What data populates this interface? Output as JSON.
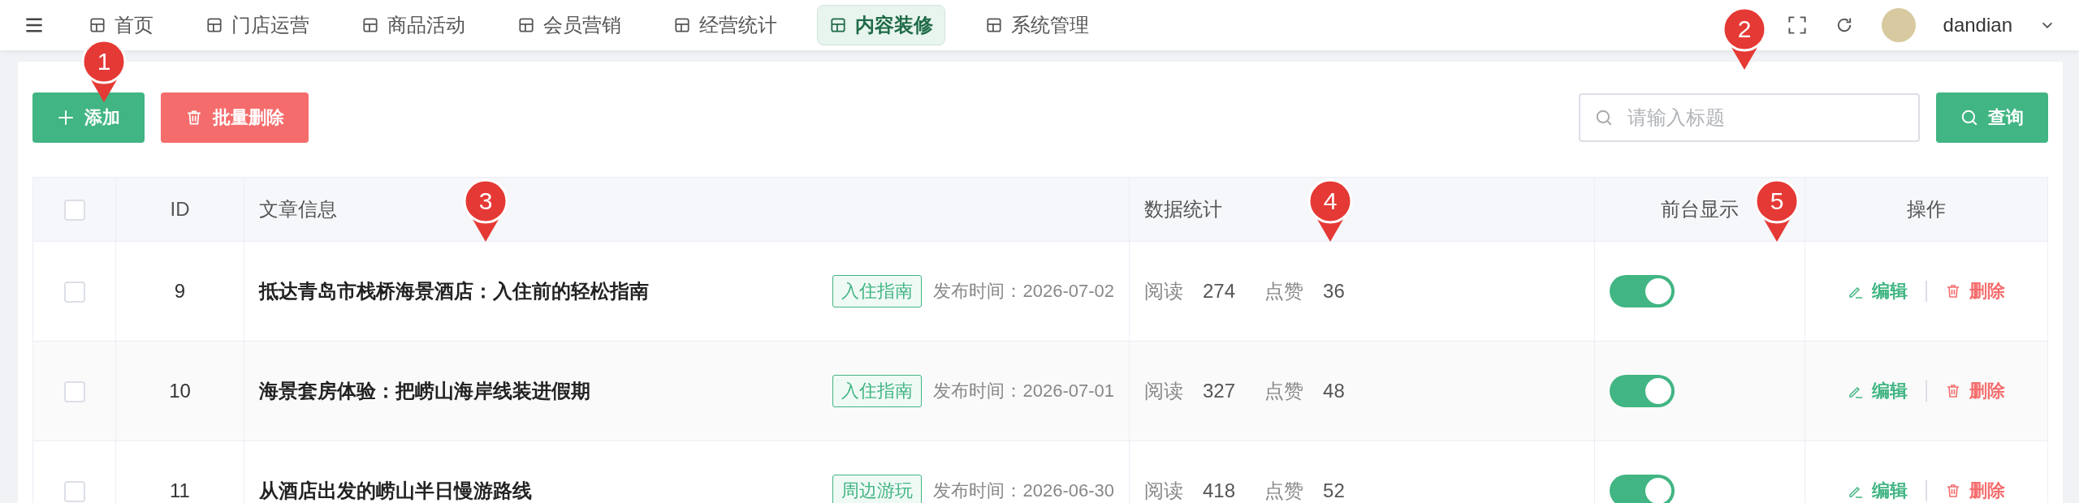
{
  "nav": {
    "items": [
      {
        "label": "首页",
        "selected": false
      },
      {
        "label": "门店运营",
        "selected": false
      },
      {
        "label": "商品活动",
        "selected": false
      },
      {
        "label": "会员营销",
        "selected": false
      },
      {
        "label": "经营统计",
        "selected": false
      },
      {
        "label": "内容装修",
        "selected": true
      },
      {
        "label": "系统管理",
        "selected": false
      }
    ],
    "user": "dandian"
  },
  "toolbar": {
    "add": "添加",
    "batch_delete": "批量删除",
    "search": {
      "placeholder": "请输入标题"
    },
    "query": "查询"
  },
  "table": {
    "select_all_checked": false,
    "columns": [
      "ID",
      "文章信息",
      "数据统计",
      "前台显示",
      "操作"
    ],
    "rows": [
      {
        "checked": false,
        "id": "9",
        "title": "抵达青岛市栈桥海景酒店：入住前的轻松指南",
        "tag": "入住指南",
        "published": "发布时间：2026-07-02",
        "read_label": "阅读",
        "reads": "274",
        "like_label": "点赞",
        "likes": "36",
        "on": true,
        "edit": "编辑",
        "delete": "删除"
      },
      {
        "checked": false,
        "id": "10",
        "title": "海景套房体验：把崂山海岸线装进假期",
        "tag": "入住指南",
        "published": "发布时间：2026-07-01",
        "read_label": "阅读",
        "reads": "327",
        "like_label": "点赞",
        "likes": "48",
        "on": true,
        "edit": "编辑",
        "delete": "删除"
      },
      {
        "checked": false,
        "id": "11",
        "title": "从酒店出发的崂山半日慢游路线",
        "tag": "周边游玩",
        "published": "发布时间：2026-06-30",
        "read_label": "阅读",
        "reads": "418",
        "like_label": "点赞",
        "likes": "52",
        "on": true,
        "edit": "编辑",
        "delete": "删除"
      }
    ]
  },
  "markers": [
    "1",
    "2",
    "3",
    "4",
    "5"
  ]
}
